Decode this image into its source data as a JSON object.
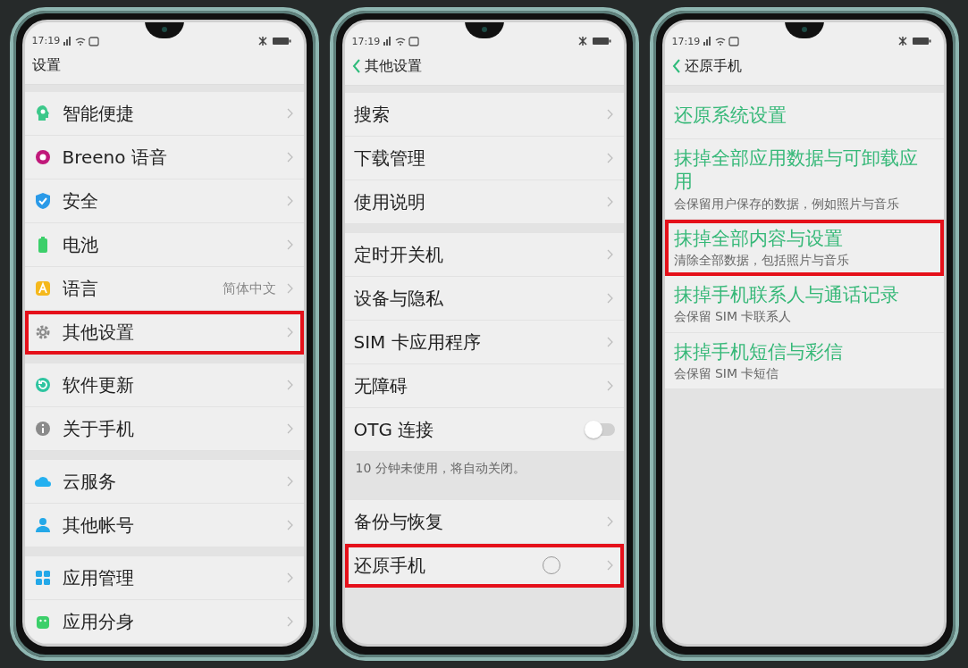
{
  "phones": [
    {
      "status_time": "17:19",
      "title": "设置",
      "back": false,
      "groups": [
        {
          "items": [
            {
              "kind": "nav",
              "label": "智能便捷",
              "highlighted": false
            },
            {
              "kind": "nav",
              "label": "Breeno 语音",
              "highlighted": false
            },
            {
              "kind": "nav",
              "label": "安全",
              "highlighted": false
            },
            {
              "kind": "nav",
              "label": "电池",
              "highlighted": false
            },
            {
              "kind": "nav",
              "label": "语言",
              "value": "简体中文",
              "highlighted": false
            },
            {
              "kind": "nav",
              "label": "其他设置",
              "highlighted": true
            }
          ]
        },
        {
          "items": [
            {
              "kind": "nav",
              "label": "软件更新",
              "highlighted": false
            },
            {
              "kind": "nav",
              "label": "关于手机",
              "highlighted": false
            }
          ]
        },
        {
          "items": [
            {
              "kind": "nav",
              "label": "云服务",
              "highlighted": false
            },
            {
              "kind": "nav",
              "label": "其他帐号",
              "highlighted": false
            }
          ]
        },
        {
          "items": [
            {
              "kind": "nav",
              "label": "应用管理",
              "highlighted": false
            },
            {
              "kind": "nav",
              "label": "应用分身",
              "highlighted": false
            }
          ]
        }
      ]
    },
    {
      "status_time": "17:19",
      "title": "其他设置",
      "back": true,
      "groups": [
        {
          "items": [
            {
              "kind": "nav",
              "label": "搜索",
              "highlighted": false
            },
            {
              "kind": "nav",
              "label": "下载管理",
              "highlighted": false
            },
            {
              "kind": "nav",
              "label": "使用说明",
              "highlighted": false
            }
          ]
        },
        {
          "items": [
            {
              "kind": "nav",
              "label": "定时开关机",
              "highlighted": false
            },
            {
              "kind": "nav",
              "label": "设备与隐私",
              "highlighted": false
            },
            {
              "kind": "nav",
              "label": "SIM 卡应用程序",
              "highlighted": false
            },
            {
              "kind": "nav",
              "label": "无障碍",
              "highlighted": false
            },
            {
              "kind": "toggle",
              "label": "OTG 连接",
              "on": false,
              "highlighted": false
            },
            {
              "kind": "note",
              "label": "10 分钟未使用，将自动关闭。"
            }
          ]
        },
        {
          "items": [
            {
              "kind": "nav",
              "label": "备份与恢复",
              "highlighted": false
            },
            {
              "kind": "nav",
              "label": "还原手机",
              "highlighted": true,
              "touched": true
            }
          ]
        }
      ]
    },
    {
      "status_time": "17:19",
      "title": "还原手机",
      "back": true,
      "groups": [
        {
          "items": [
            {
              "kind": "action",
              "label": "还原系统设置",
              "highlighted": false
            },
            {
              "kind": "action",
              "label": "抹掉全部应用数据与可卸载应用",
              "description": "会保留用户保存的数据，例如照片与音乐",
              "highlighted": false
            },
            {
              "kind": "action",
              "label": "抹掉全部内容与设置",
              "description": "清除全部数据，包括照片与音乐",
              "highlighted": true
            },
            {
              "kind": "action",
              "label": "抹掉手机联系人与通话记录",
              "description": "会保留 SIM 卡联系人",
              "highlighted": false
            },
            {
              "kind": "action",
              "label": "抹掉手机短信与彩信",
              "description": "会保留 SIM 卡短信",
              "highlighted": false
            }
          ]
        }
      ]
    }
  ]
}
